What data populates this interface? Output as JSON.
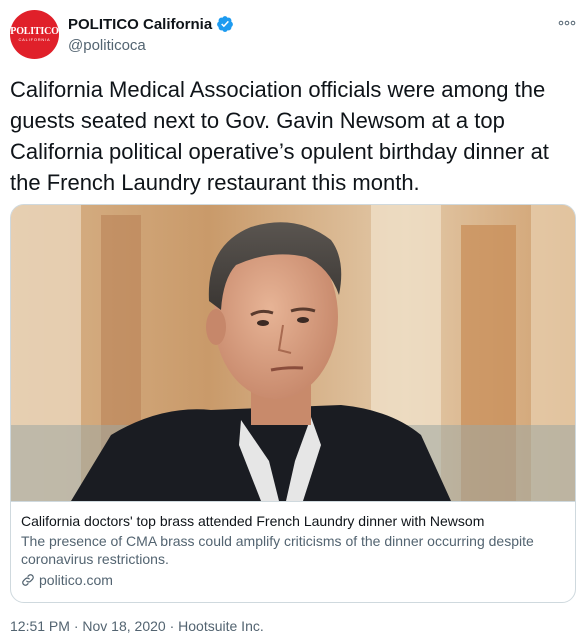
{
  "account": {
    "display_name": "POLITICO California",
    "handle": "@politicoca",
    "avatar_logo": "POLITICO",
    "avatar_sub": "CALIFORNIA",
    "verified_icon": "verified-badge-icon"
  },
  "tweet": {
    "text": "California Medical Association officials were among the guests seated next to Gov. Gavin Newsom at a top California political operative’s opulent birthday dinner at the French Laundry restaurant this month."
  },
  "card": {
    "title": "California doctors' top brass attended French Laundry dinner with Newsom",
    "description": "The presence of CMA brass could amplify criticisms of the dinner occurring despite coronavirus restrictions.",
    "domain": "politico.com",
    "domain_icon": "link-icon"
  },
  "meta": {
    "time": "12:51 PM",
    "separator": " · ",
    "date": "Nov 18, 2020",
    "source": "Hootsuite Inc."
  },
  "colors": {
    "text_primary": "#0f1419",
    "text_secondary": "#536471",
    "verified_blue": "#1d9bf0",
    "brand_red": "#e0202a",
    "border": "#cfd9de"
  }
}
